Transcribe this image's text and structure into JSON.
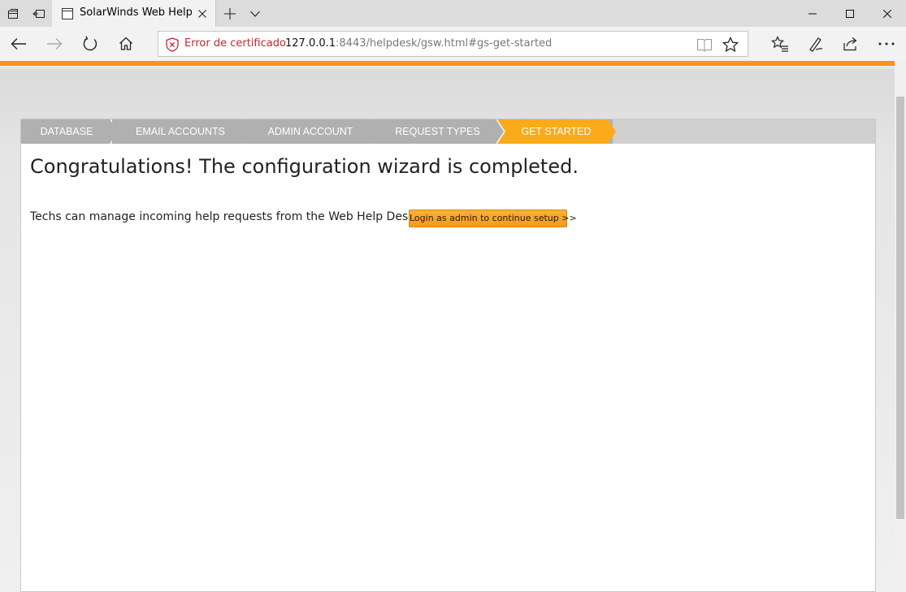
{
  "browser": {
    "tab_title": "SolarWinds Web Help D",
    "cert_error": "Error de certificado",
    "url_host": "127.0.0.1",
    "url_rest": ":8443/helpdesk/gsw.html#gs-get-started",
    "icons": {
      "tabs_aside": "tabs-aside-icon",
      "tab_preview": "tab-preview-icon",
      "favicon": "page-favicon-icon",
      "close_tab": "close-icon",
      "new_tab": "plus-icon",
      "tab_menu": "chevron-down-icon",
      "back": "back-arrow-icon",
      "forward": "forward-arrow-icon",
      "refresh": "refresh-icon",
      "home": "home-icon",
      "cert": "shield-error-icon",
      "reading_view": "reading-view-icon",
      "favorite": "star-icon",
      "favorites_hub": "favorites-hub-icon",
      "notes": "pen-icon",
      "share": "share-icon",
      "more": "more-icon"
    },
    "colors": {
      "cert_error": "#c5262c",
      "accent_orange": "#f7941d"
    }
  },
  "wizard": {
    "steps": [
      {
        "label": "DATABASE",
        "state": "done"
      },
      {
        "label": "EMAIL ACCOUNTS",
        "state": "done"
      },
      {
        "label": "ADMIN ACCOUNT",
        "state": "done"
      },
      {
        "label": "REQUEST TYPES",
        "state": "done"
      },
      {
        "label": "GET STARTED",
        "state": "active"
      }
    ],
    "colors": {
      "step_done": "#b0b0b0",
      "step_active": "#fbaa19",
      "button": "#f7a12a"
    },
    "heading": "Congratulations! The configuration wizard is completed.",
    "description": "Techs can manage incoming help requests from the Web Help Desk.",
    "login_button": "Login as admin to continue setup >>"
  }
}
